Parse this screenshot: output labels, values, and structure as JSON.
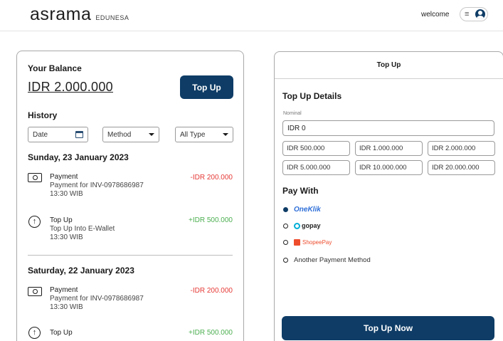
{
  "header": {
    "logo_main": "asrama",
    "logo_sub": "EDUNESA",
    "welcome": "welcome",
    "menu_icon": "hamburger-icon",
    "avatar_icon": "user-avatar-icon"
  },
  "balance": {
    "title": "Your Balance",
    "amount": "IDR 2.000.000",
    "topup_label": "Top Up"
  },
  "history": {
    "title": "History",
    "filters": {
      "date_placeholder": "Date",
      "method_value": "Method",
      "type_value": "All Type"
    },
    "days": [
      {
        "label": "Sunday, 23 January 2023",
        "items": [
          {
            "icon": "cash-icon",
            "title": "Payment",
            "desc": "Payment for INV-0978686987",
            "time": "13:30 WIB",
            "amount": "-IDR 200.000"
          },
          {
            "icon": "arrow-up-circle-icon",
            "title": "Top Up",
            "desc": "Top Up Into E-Wallet",
            "time": "13:30 WIB",
            "amount": "+IDR 500.000"
          }
        ]
      },
      {
        "label": "Saturday, 22 January 2023",
        "items": [
          {
            "icon": "cash-icon",
            "title": "Payment",
            "desc": "Payment for INV-0978686987",
            "time": "13:30 WIB",
            "amount": "-IDR 200.000"
          },
          {
            "icon": "arrow-up-circle-icon",
            "title": "Top Up",
            "desc": "",
            "time": "",
            "amount": "+IDR 500.000"
          }
        ]
      }
    ]
  },
  "topup_panel": {
    "header": "Top Up",
    "details_title": "Top Up Details",
    "nominal_label": "Nominal",
    "nominal_value": "IDR 0",
    "presets": [
      "IDR 500.000",
      "IDR 1.000.000",
      "IDR 2.000.000",
      "IDR 5.000.000",
      "IDR 10.000.000",
      "IDR 20.000.000"
    ],
    "pay_with_title": "Pay With",
    "methods": [
      "OneKlik",
      "gopay",
      "ShopeePay",
      "Another Payment Method"
    ],
    "selected_method": "OneKlik",
    "submit_label": "Top Up Now"
  },
  "colors": {
    "primary": "#0e3c66",
    "negative": "#e53935",
    "positive": "#4caf50"
  }
}
